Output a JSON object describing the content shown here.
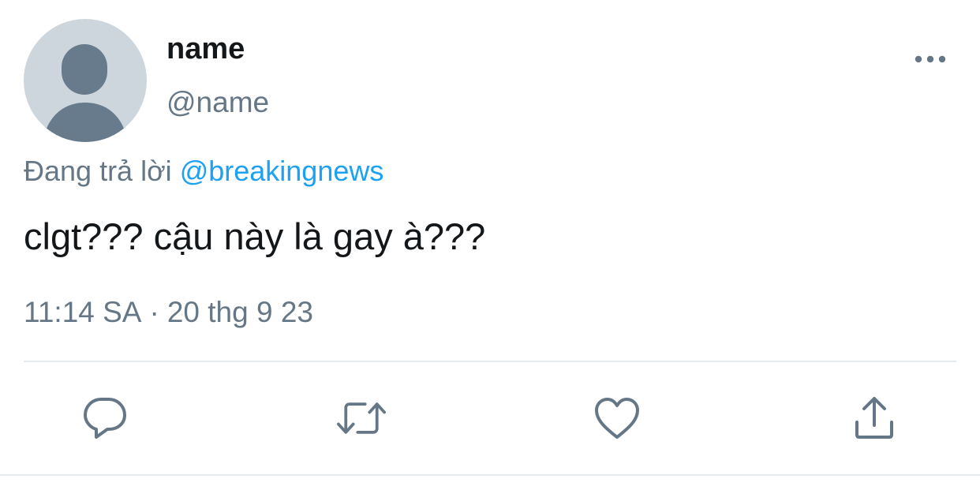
{
  "tweet": {
    "author": {
      "display_name": "name",
      "handle": "@name",
      "avatar_icon": "default-profile-silhouette-icon"
    },
    "reply_context": {
      "prefix": "Đang trả lời",
      "mention": "@breakingnews"
    },
    "text": "clgt??? cậu này là gay à???",
    "timestamp": {
      "time": "11:14 SA",
      "separator": "·",
      "date": "20 thg 9 23"
    }
  },
  "actions": [
    {
      "name": "reply",
      "icon": "comment-bubble-icon"
    },
    {
      "name": "retweet",
      "icon": "retweet-arrows-icon"
    },
    {
      "name": "like",
      "icon": "heart-icon"
    },
    {
      "name": "share",
      "icon": "share-upload-icon"
    }
  ],
  "menu": {
    "icon": "more-horizontal-icon"
  },
  "colors": {
    "text_primary": "#14171a",
    "text_secondary": "#657786",
    "link": "#1da1f2",
    "avatar_bg": "#cdd6dd",
    "avatar_figure": "#687b8c",
    "divider": "#e6ecf0"
  }
}
